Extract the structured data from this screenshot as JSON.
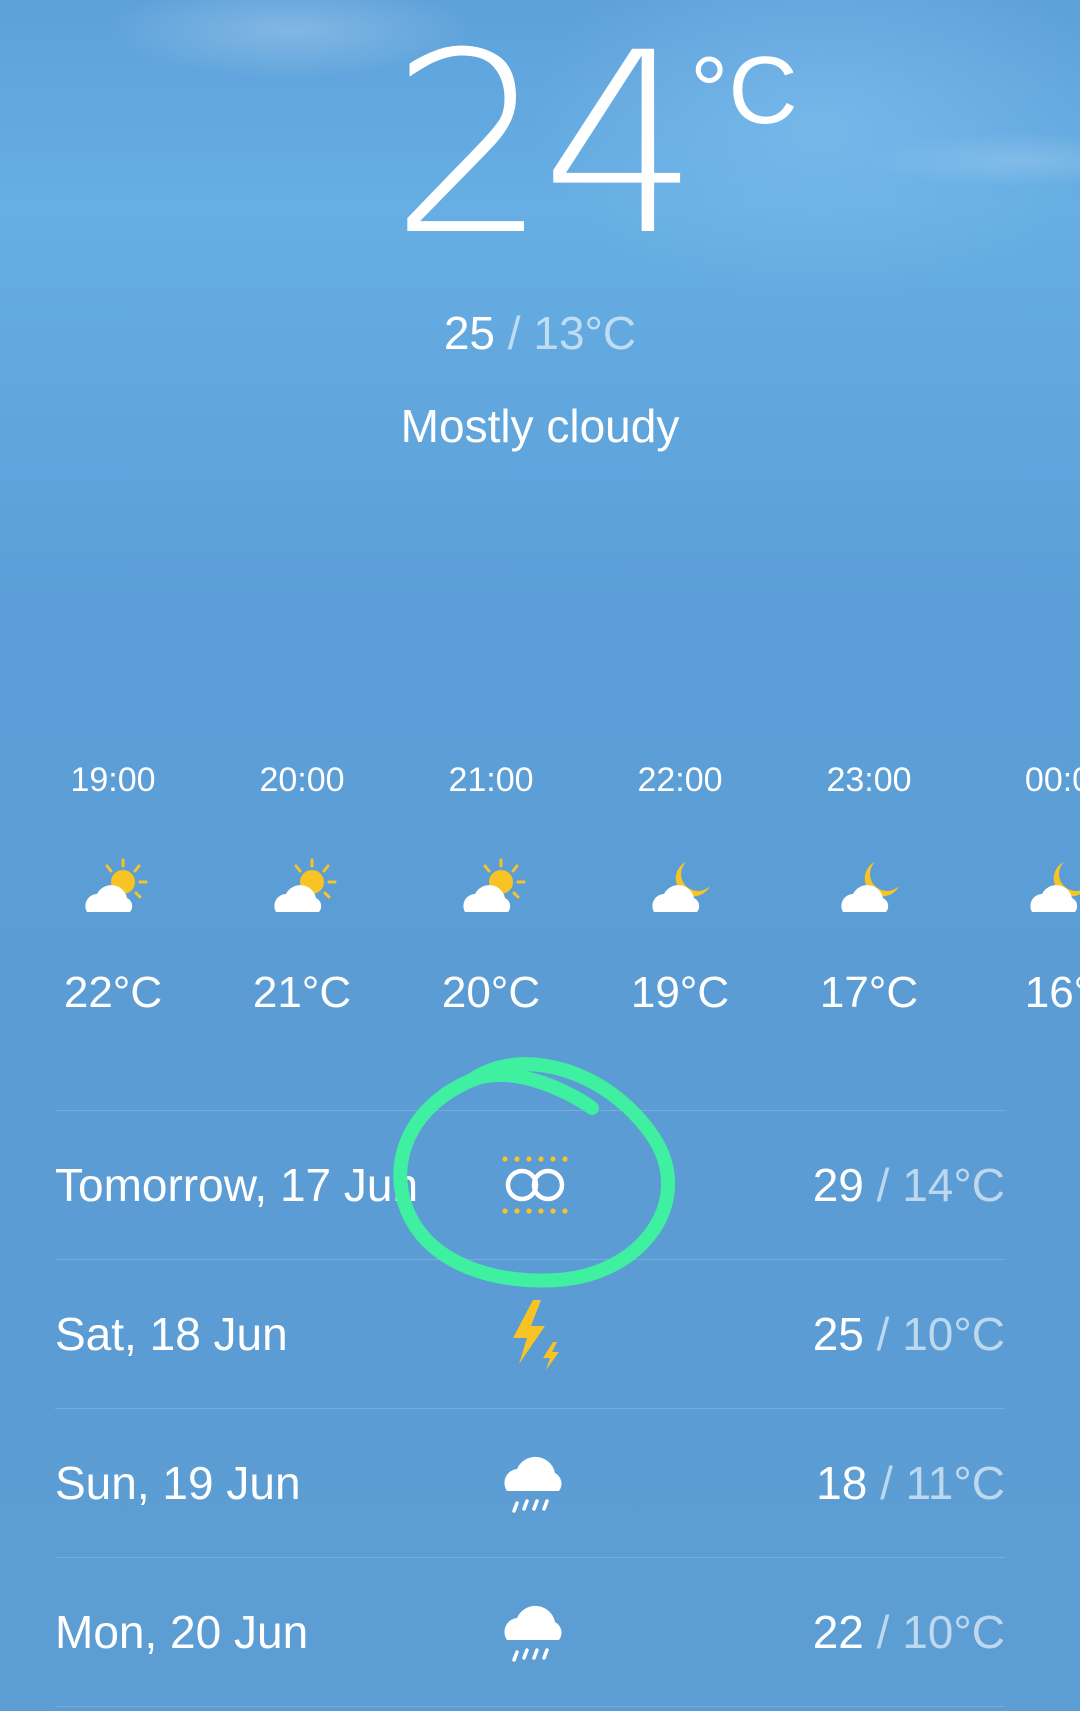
{
  "current": {
    "temperature": "24",
    "unit": "°C",
    "high": "25",
    "low": "13°C",
    "separator": "/",
    "condition": "Mostly cloudy"
  },
  "hourly": [
    {
      "time": "19:00",
      "icon": "partly-cloudy-day-icon",
      "temp": "22°C"
    },
    {
      "time": "20:00",
      "icon": "partly-cloudy-day-icon",
      "temp": "21°C"
    },
    {
      "time": "21:00",
      "icon": "partly-cloudy-day-icon",
      "temp": "20°C"
    },
    {
      "time": "22:00",
      "icon": "partly-cloudy-night-icon",
      "temp": "19°C"
    },
    {
      "time": "23:00",
      "icon": "partly-cloudy-night-icon",
      "temp": "17°C"
    },
    {
      "time": "00:0",
      "icon": "partly-cloudy-night-icon",
      "temp": "16°"
    }
  ],
  "daily": [
    {
      "day": "Tomorrow, 17 Jun",
      "icon": "haze-icon",
      "high": "29",
      "low": "14°C",
      "separator": "/"
    },
    {
      "day": "Sat, 18 Jun",
      "icon": "thunder-icon",
      "high": "25",
      "low": "10°C",
      "separator": "/"
    },
    {
      "day": "Sun, 19 Jun",
      "icon": "rain-icon",
      "high": "18",
      "low": "11°C",
      "separator": "/"
    },
    {
      "day": "Mon, 20 Jun",
      "icon": "rain-icon",
      "high": "22",
      "low": "10°C",
      "separator": "/"
    }
  ],
  "colors": {
    "sky": "#5c9dd4",
    "sun": "#f7c325",
    "annotation": "#3ef0a0"
  }
}
